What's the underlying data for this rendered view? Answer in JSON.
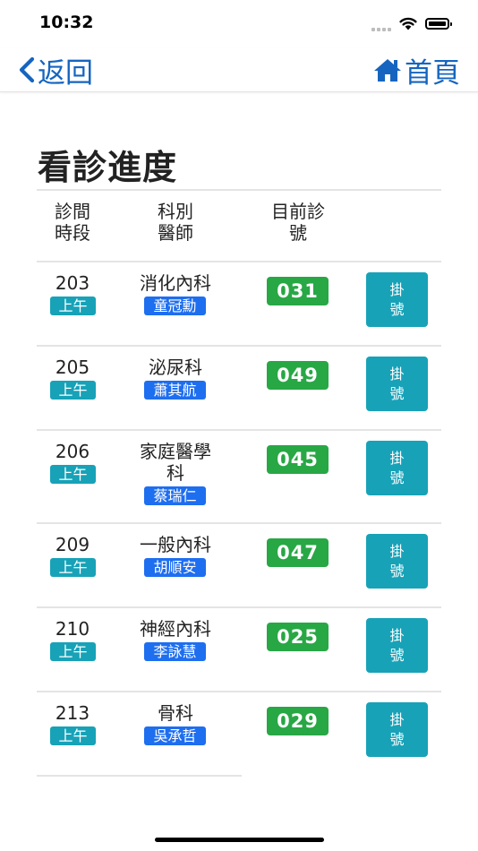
{
  "status": {
    "time": "10:32"
  },
  "nav": {
    "back_label": "返回",
    "home_label": "首頁"
  },
  "page": {
    "title": "看診進度"
  },
  "columns": {
    "room_period": "診間\n時段",
    "dept_doctor": "科別\n醫師",
    "current_number": "目前診\n號"
  },
  "rows": [
    {
      "room": "203",
      "period": "上午",
      "dept": "消化內科",
      "doctor": "童冠勳",
      "number": "031",
      "action": "掛號"
    },
    {
      "room": "205",
      "period": "上午",
      "dept": "泌尿科",
      "doctor": "蕭其航",
      "number": "049",
      "action": "掛號"
    },
    {
      "room": "206",
      "period": "上午",
      "dept": "家庭醫學科",
      "doctor": "蔡瑞仁",
      "number": "045",
      "action": "掛號"
    },
    {
      "room": "209",
      "period": "上午",
      "dept": "一般內科",
      "doctor": "胡順安",
      "number": "047",
      "action": "掛號"
    },
    {
      "room": "210",
      "period": "上午",
      "dept": "神經內科",
      "doctor": "李詠慧",
      "number": "025",
      "action": "掛號"
    },
    {
      "room": "213",
      "period": "上午",
      "dept": "骨科",
      "doctor": "吳承哲",
      "number": "029",
      "action": "掛號"
    }
  ],
  "colors": {
    "nav_accent": "#1565c0",
    "period_badge": "#17a2b8",
    "doctor_badge": "#1e6ef0",
    "number_badge": "#28a745",
    "register_button": "#17a2b8"
  }
}
